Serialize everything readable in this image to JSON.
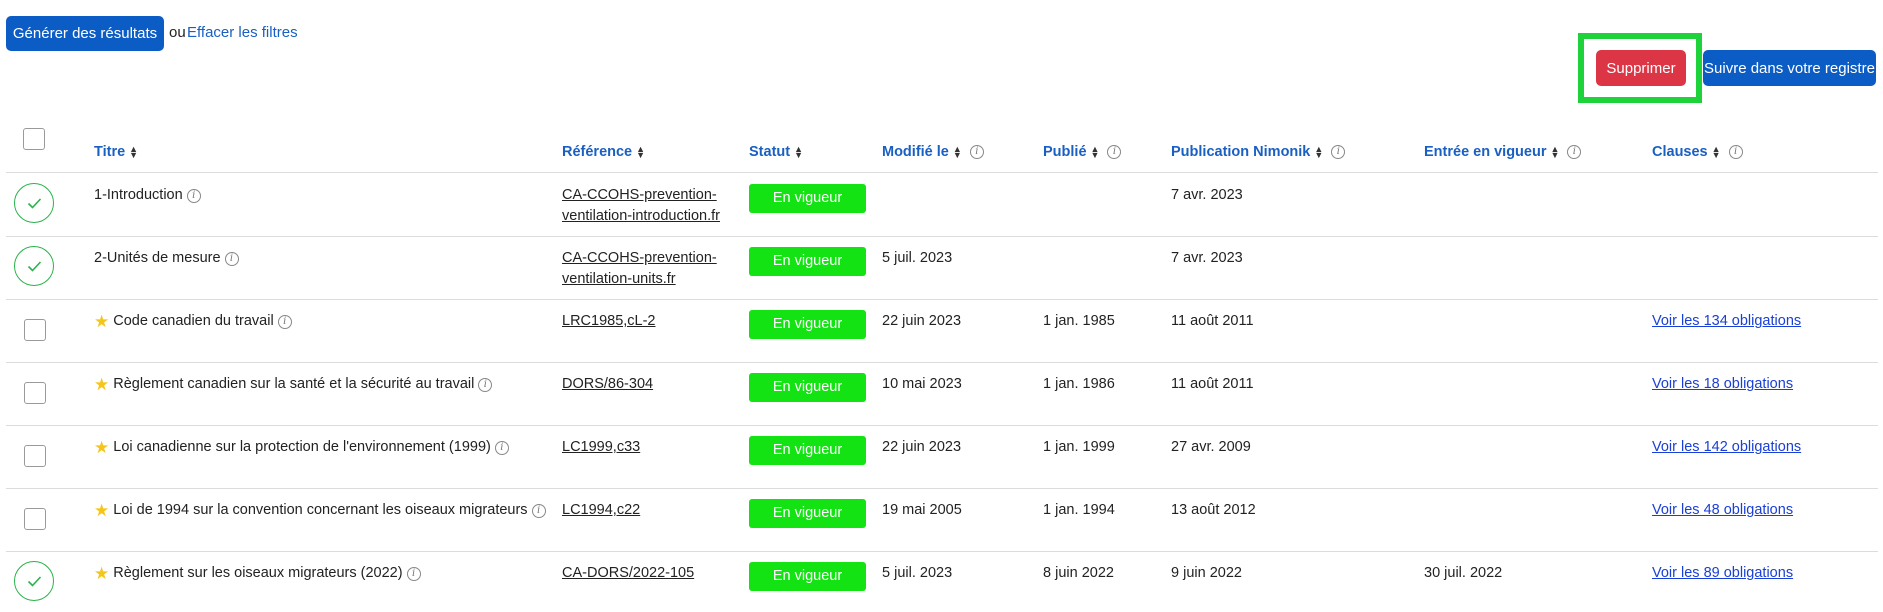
{
  "toolbar": {
    "generate_label": "Générer des résultats",
    "or_text": "ou",
    "clear_label": "Effacer les filtres",
    "delete_label": "Supprimer",
    "follow_label": "Suivre dans votre registre"
  },
  "table": {
    "headers": {
      "title": "Titre",
      "reference": "Référence",
      "status": "Statut",
      "modified": "Modifié le",
      "published": "Publié",
      "nimonik": "Publication Nimonik",
      "effective": "Entrée en vigueur",
      "clauses": "Clauses"
    },
    "rows": [
      {
        "selected": true,
        "starred": false,
        "title": "1-Introduction",
        "reference": [
          "CA-CCOHS-prevention-",
          "ventilation-introduction.fr"
        ],
        "status": "En vigueur",
        "modified": "",
        "published": "",
        "nimonik": "7 avr. 2023",
        "effective": "",
        "clauses": ""
      },
      {
        "selected": true,
        "starred": false,
        "title": "2-Unités de mesure",
        "reference": [
          "CA-CCOHS-prevention-",
          "ventilation-units.fr"
        ],
        "status": "En vigueur",
        "modified": "5 juil. 2023",
        "published": "",
        "nimonik": "7 avr. 2023",
        "effective": "",
        "clauses": ""
      },
      {
        "selected": false,
        "starred": true,
        "title": "Code canadien du travail",
        "reference": [
          "LRC1985,cL-2"
        ],
        "status": "En vigueur",
        "modified": "22 juin 2023",
        "published": "1 jan. 1985",
        "nimonik": "11 août 2011",
        "effective": "",
        "clauses": "Voir les 134 obligations"
      },
      {
        "selected": false,
        "starred": true,
        "title": "Règlement canadien sur la santé et la sécurité au travail",
        "reference": [
          "DORS/86-304"
        ],
        "status": "En vigueur",
        "modified": "10 mai 2023",
        "published": "1 jan. 1986",
        "nimonik": "11 août 2011",
        "effective": "",
        "clauses": "Voir les 18 obligations"
      },
      {
        "selected": false,
        "starred": true,
        "title": "Loi canadienne sur la protection de l'environnement (1999)",
        "reference": [
          "LC1999,c33"
        ],
        "status": "En vigueur",
        "modified": "22 juin 2023",
        "published": "1 jan. 1999",
        "nimonik": "27 avr. 2009",
        "effective": "",
        "clauses": "Voir les 142 obligations"
      },
      {
        "selected": false,
        "starred": true,
        "title": "Loi de 1994 sur la convention concernant les oiseaux migrateurs",
        "reference": [
          "LC1994,c22"
        ],
        "status": "En vigueur",
        "modified": "19 mai 2005",
        "published": "1 jan. 1994",
        "nimonik": "13 août 2012",
        "effective": "",
        "clauses": "Voir les 48 obligations"
      },
      {
        "selected": true,
        "starred": true,
        "title": "Règlement sur les oiseaux migrateurs (2022)",
        "reference": [
          "CA-DORS/2022-105"
        ],
        "status": "En vigueur",
        "modified": "5 juil. 2023",
        "published": "8 juin 2022",
        "nimonik": "9 juin 2022",
        "effective": "30 juil. 2022",
        "clauses": "Voir les 89 obligations"
      }
    ]
  },
  "colors": {
    "primary": "#0b5cc4",
    "danger": "#dc3545",
    "status_green": "#13e313",
    "highlight": "#1ed23c",
    "link": "#1a3fd6"
  }
}
